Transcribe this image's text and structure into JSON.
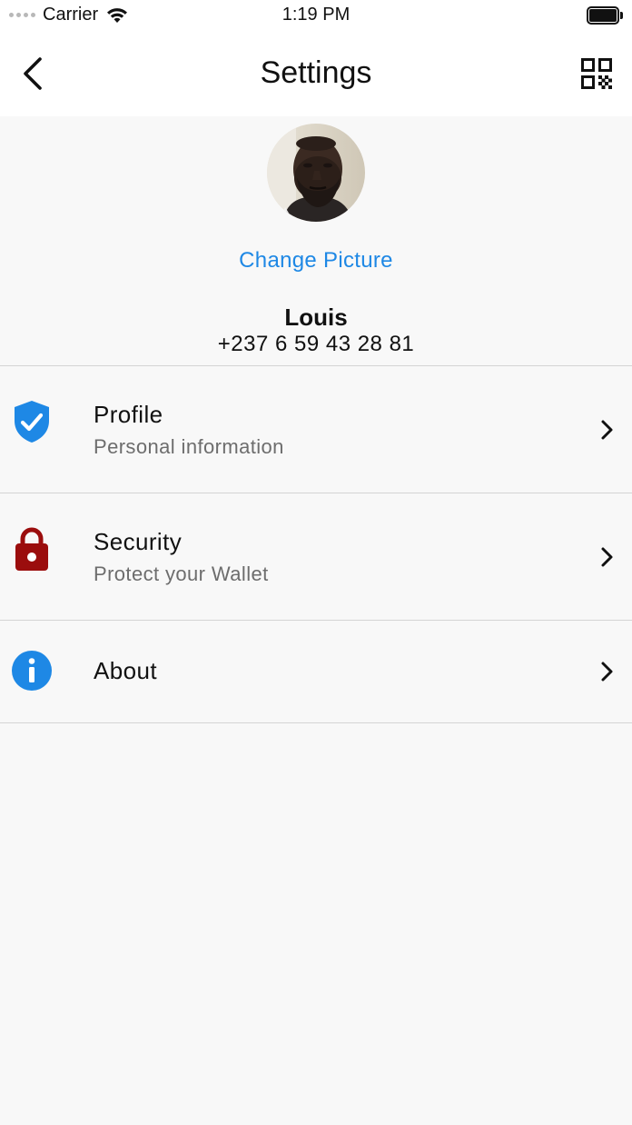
{
  "status_bar": {
    "carrier": "Carrier",
    "time": "1:19 PM"
  },
  "nav": {
    "title": "Settings"
  },
  "profile": {
    "change_picture_label": "Change Picture",
    "name": "Louis",
    "phone": "+237 6 59 43 28 81"
  },
  "menu": {
    "items": [
      {
        "title": "Profile",
        "subtitle": "Personal information",
        "icon": "shield-check-icon",
        "icon_color": "#1e88e5"
      },
      {
        "title": "Security",
        "subtitle": "Protect your Wallet",
        "icon": "lock-icon",
        "icon_color": "#9b0d0d"
      },
      {
        "title": "About",
        "subtitle": "",
        "icon": "info-icon",
        "icon_color": "#1e88e5"
      }
    ]
  },
  "colors": {
    "accent": "#1e88e5",
    "security_icon": "#9b0d0d",
    "background": "#f8f8f8"
  }
}
